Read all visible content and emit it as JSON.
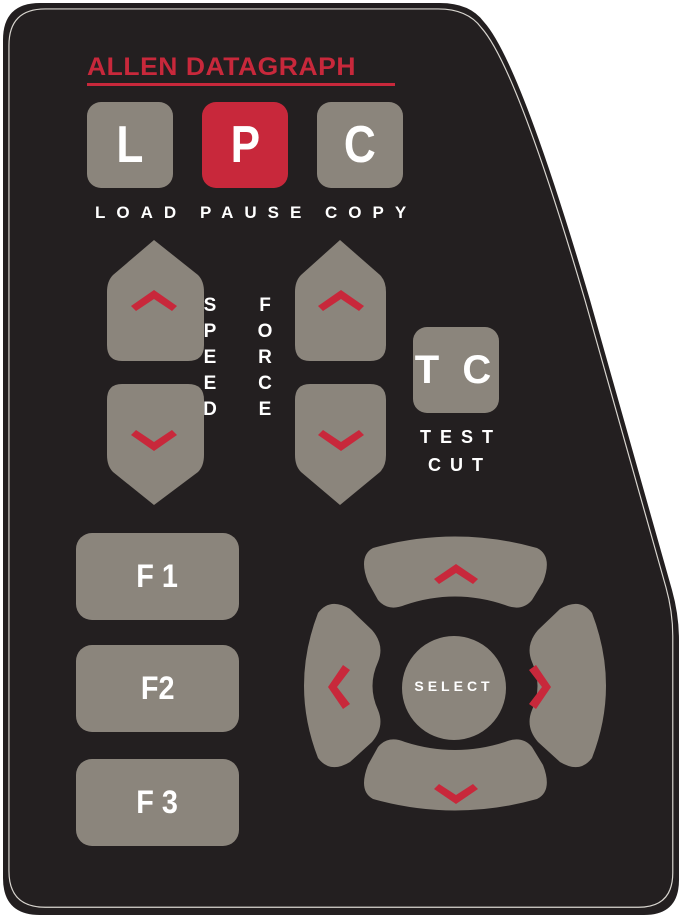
{
  "brand": {
    "name": "ALLEN DATAGRAPH"
  },
  "top_keys": [
    {
      "key": "L",
      "label": "LOAD"
    },
    {
      "key": "P",
      "label": "PAUSE"
    },
    {
      "key": "C",
      "label": "COPY"
    }
  ],
  "speed": {
    "label_letters": [
      "S",
      "P",
      "E",
      "E",
      "D"
    ]
  },
  "force": {
    "label_letters": [
      "F",
      "O",
      "R",
      "C",
      "E"
    ]
  },
  "test_cut": {
    "key": "T C",
    "label_line1": "TEST",
    "label_line2": "CUT"
  },
  "function_keys": [
    "F 1",
    "F2",
    "F 3"
  ],
  "nav": {
    "select_label": "SELECT"
  },
  "colors": {
    "panel": "#231f20",
    "key_gray": "#8b857c",
    "accent_red": "#c8283b",
    "text": "#ffffff"
  }
}
